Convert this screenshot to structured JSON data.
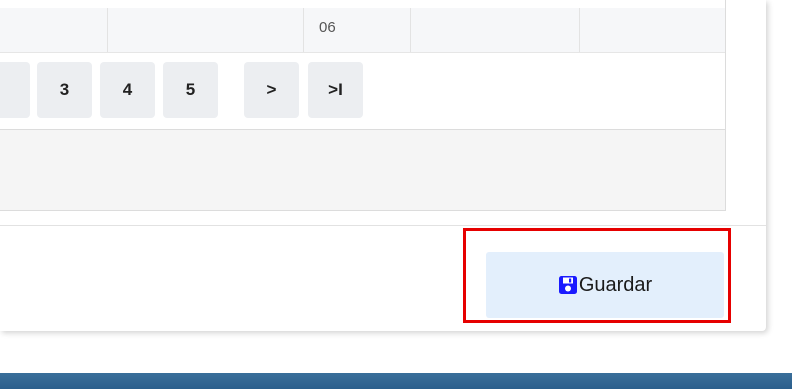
{
  "table": {
    "visible_cell": "06"
  },
  "pagination": {
    "pages": [
      "3",
      "4",
      "5"
    ],
    "next_label": ">",
    "last_label": ">I"
  },
  "footer": {
    "save_label": "Guardar",
    "save_icon": "floppy-disk-icon",
    "save_icon_color": "#1a1aff",
    "highlight_color": "#e60000"
  }
}
